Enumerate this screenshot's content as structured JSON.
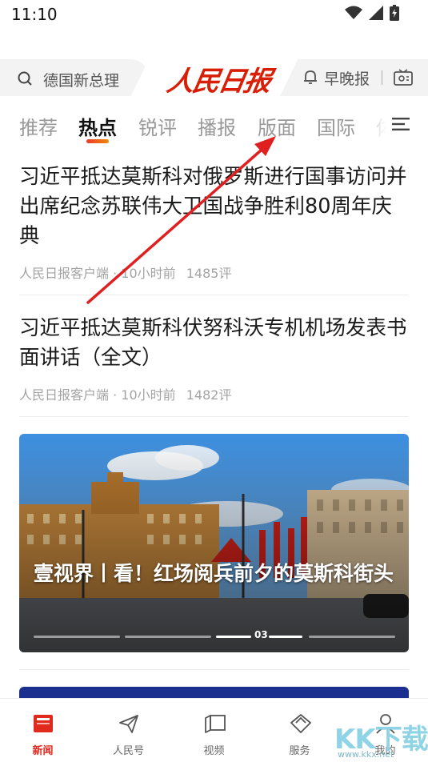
{
  "status_bar": {
    "time": "11:10"
  },
  "header": {
    "search_text": "德国新总理",
    "logo_text": "人民日报",
    "brief_label": "早晚报"
  },
  "tabs": [
    {
      "label": "推荐",
      "active": false
    },
    {
      "label": "热点",
      "active": true
    },
    {
      "label": "锐评",
      "active": false
    },
    {
      "label": "播报",
      "active": false
    },
    {
      "label": "版面",
      "active": false
    },
    {
      "label": "国际",
      "active": false
    },
    {
      "label": "体",
      "active": false
    }
  ],
  "articles": [
    {
      "title": "习近平抵达莫斯科对俄罗斯进行国事访问并出席纪念苏联伟大卫国战争胜利80周年庆典",
      "source": "人民日报客户端",
      "time": "10小时前",
      "comments": "1485评"
    },
    {
      "title": "习近平抵达莫斯科伏努科沃专机机场发表书面讲话（全文）",
      "source": "人民日报客户端",
      "time": "10小时前",
      "comments": "1482评"
    }
  ],
  "hero": {
    "caption": "壹视界丨看！红场阅兵前夕的莫斯科街头",
    "page_number": "03"
  },
  "bottom_nav": [
    {
      "label": "新闻",
      "icon": "news-icon",
      "active": true
    },
    {
      "label": "人民号",
      "icon": "send-icon",
      "active": false
    },
    {
      "label": "视频",
      "icon": "video-icon",
      "active": false
    },
    {
      "label": "服务",
      "icon": "service-icon",
      "active": false
    },
    {
      "label": "我的",
      "icon": "profile-icon",
      "active": false
    }
  ],
  "watermark": {
    "text": "KK下载",
    "url": "www.kkx.net"
  },
  "colors": {
    "brand": "#d81e06",
    "accent_gradient_start": "#e83a2e",
    "accent_gradient_end": "#f08a00",
    "annotation_arrow": "#e02020"
  }
}
